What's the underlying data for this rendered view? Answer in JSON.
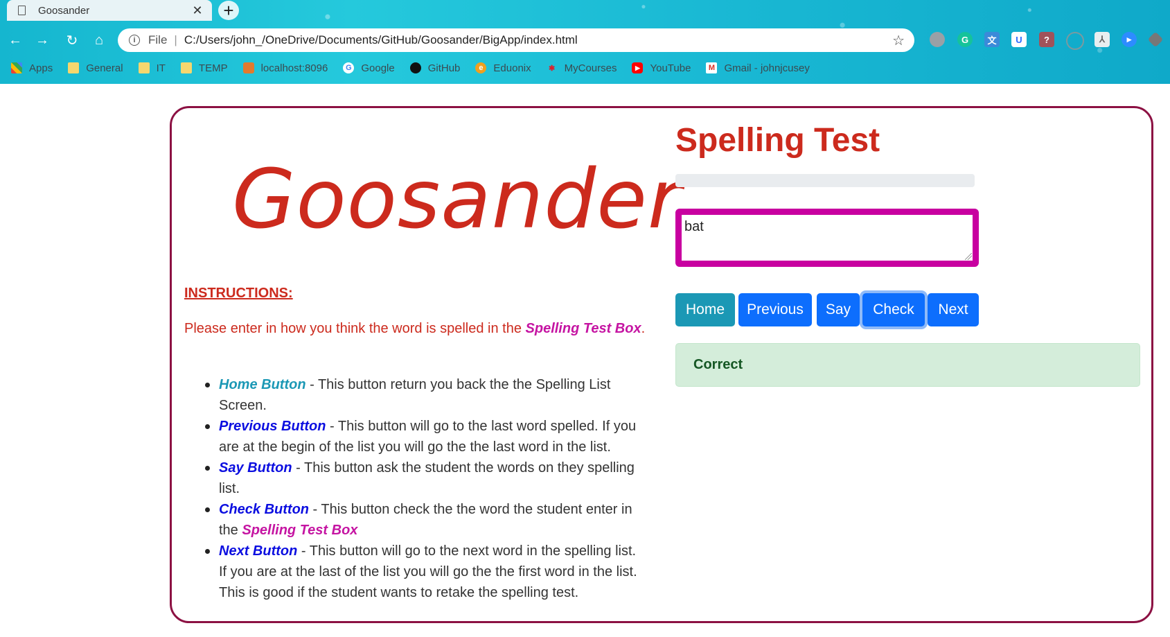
{
  "browser": {
    "tab_title": "Goosander",
    "file_label": "File",
    "url": "C:/Users/john_/OneDrive/Documents/GitHub/Goosander/BigApp/index.html",
    "bookmarks": [
      {
        "label": "Apps"
      },
      {
        "label": "General"
      },
      {
        "label": "IT"
      },
      {
        "label": "TEMP"
      },
      {
        "label": "localhost:8096"
      },
      {
        "label": "Google"
      },
      {
        "label": "GitHub"
      },
      {
        "label": "Eduonix"
      },
      {
        "label": "MyCourses"
      },
      {
        "label": "YouTube"
      },
      {
        "label": "Gmail - johnjcusey"
      }
    ]
  },
  "page": {
    "logo": "Goosander",
    "instructions_heading": "INSTRUCTIONS:",
    "intro_prefix": "Please enter in how you think the word is spelled in the ",
    "intro_highlight": "Spelling Test Box",
    "intro_suffix": ".",
    "help": [
      {
        "name": "Home Button",
        "text": " - This button return you back the the Spelling List Screen."
      },
      {
        "name": "Previous Button",
        "text": " - This button will go to the last word spelled. If you are at the begin of the list you will go the the last word in the list."
      },
      {
        "name": "Say Button",
        "text": " - This button ask the student the words on they spelling list."
      },
      {
        "name": "Check Button",
        "text": " - This button check the the word the student enter in the ",
        "extra": "Spelling Test Box"
      },
      {
        "name": "Next Button",
        "text": " - This button will go to the next word in the spelling list. If you are at the last of the list you will go the the first word in the list. This is good if the student wants to retake the spelling test."
      }
    ],
    "title": "Spelling Test",
    "progress_percent": 0,
    "answer_value": "bat",
    "buttons": {
      "home": "Home",
      "previous": "Previous",
      "say": "Say",
      "check": "Check",
      "next": "Next"
    },
    "result": "Correct"
  },
  "colors": {
    "accent_red": "#cc2a1d",
    "highlight_pink": "#c514a2",
    "button_blue": "#0d6efd",
    "button_teal": "#1b98b5",
    "success_bg": "#d4edda",
    "card_border": "#8c1143"
  }
}
